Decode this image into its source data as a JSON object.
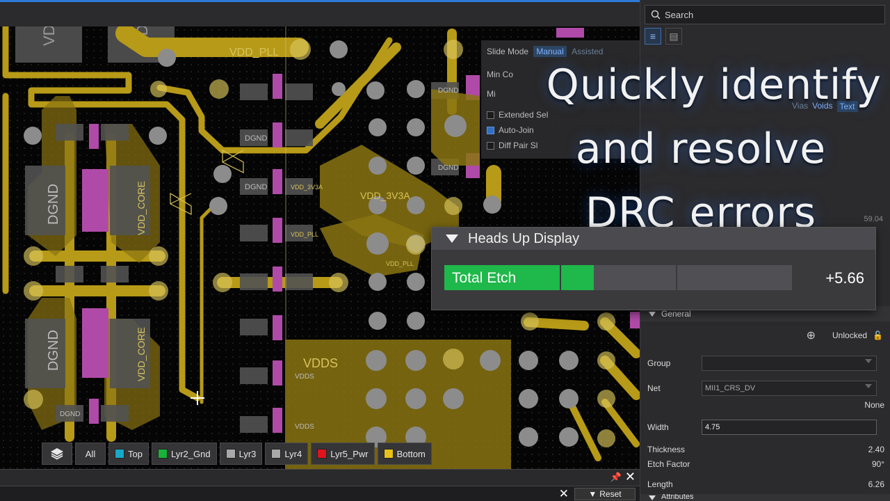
{
  "search": {
    "placeholder": "Search"
  },
  "overlay": {
    "line1": "Quickly identify",
    "line2": "and resolve",
    "line3": "DRC errors"
  },
  "slide_mode": {
    "label": "Slide Mode",
    "tabs": [
      "Manual",
      "Assisted"
    ],
    "min_label": "Min Co",
    "max_label": "Mi",
    "checks": [
      {
        "label": "Extended Sel",
        "checked": false
      },
      {
        "label": "Auto-Join",
        "checked": true
      },
      {
        "label": "Diff Pair Sl",
        "checked": false
      }
    ],
    "right_chips": [
      "Vias",
      "Voids",
      "Text"
    ]
  },
  "hud": {
    "title": "Heads Up Display",
    "metric_label": "Total Etch",
    "metric_value": "+5.66",
    "fill_fraction": 0.43,
    "aside_value": "59.04"
  },
  "layers": {
    "all_label": "All",
    "items": [
      {
        "label": "Top",
        "color": "#17a9c9"
      },
      {
        "label": "Lyr2_Gnd",
        "color": "#19b238"
      },
      {
        "label": "Lyr3",
        "color": "#a8a8a8"
      },
      {
        "label": "Lyr4",
        "color": "#a8a8a8"
      },
      {
        "label": "Lyr5_Pwr",
        "color": "#e0141c"
      },
      {
        "label": "Bottom",
        "color": "#e8c21a"
      }
    ]
  },
  "bottom": {
    "reset_label": "Reset"
  },
  "properties": {
    "general_label": "General",
    "lock_label": "Unlocked",
    "group_label": "Group",
    "group_value": "",
    "net_label": "Net",
    "net_value": "MII1_CRS_DV",
    "none_label": "None",
    "width_label": "Width",
    "width_value": "4.75",
    "thickness_label": "Thickness",
    "thickness_value": "2.40",
    "etch_factor_label": "Etch Factor",
    "etch_factor_value": "90°",
    "length_label": "Length",
    "length_value": "6.26",
    "attributes_label": "Attributes"
  },
  "board_labels": {
    "vdd": "VDD",
    "vdd_pll": "VDD_PLL",
    "vdd_pll_small": "VDD_PLL",
    "vdd_core": "VDD_CORE",
    "vdd_3v3a": "VDD_3V3A",
    "dgnd": "DGND",
    "vdds": "VDDS",
    "vdd_pll_pad": "VDD_PLL",
    "vdd_3v3a_big": "VDD_3V3A"
  },
  "colors": {
    "copper": "#b79a17",
    "copper_dark": "#8a7412",
    "pad": "#8c8c8c",
    "magenta": "#b04aa8",
    "hud_green": "#1fb84a",
    "accent_blue": "#2f7ad8"
  }
}
